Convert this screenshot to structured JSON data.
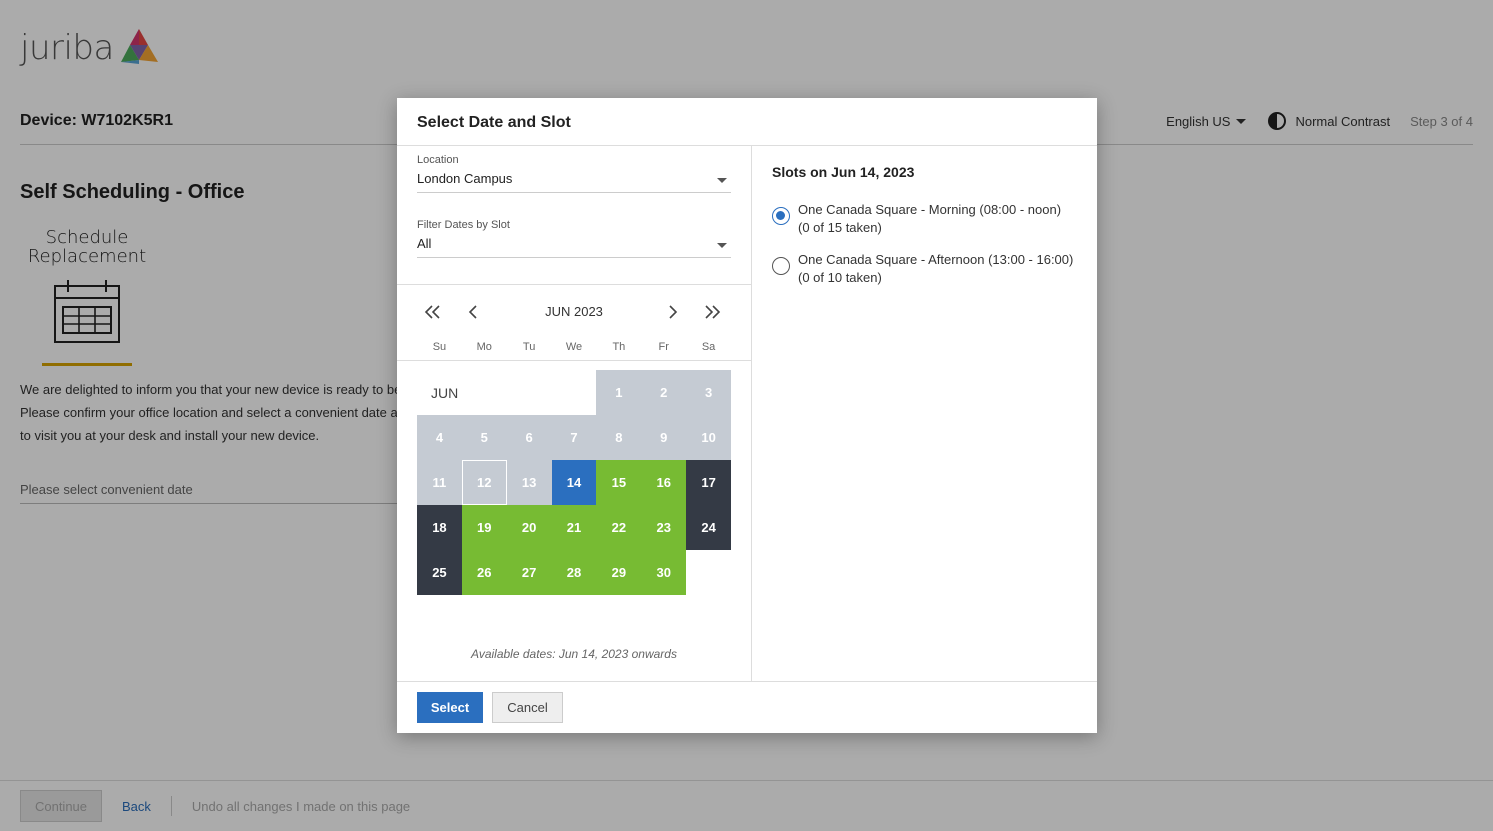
{
  "brand": {
    "logo_text": "juriba",
    "logo_icon": "juriba-triangle-logo"
  },
  "header": {
    "device_title": "Device: W7102K5R1",
    "language": "English US",
    "contrast": "Normal Contrast",
    "step": "Step 3 of 4"
  },
  "main": {
    "section_title": "Self Scheduling - Office",
    "schedule_card": {
      "line1": "Schedule",
      "line2": "Replacement",
      "icon": "calendar-icon",
      "underline_color": "#d7a300"
    },
    "intro_lines": [
      "We are delighted to inform you that your new device is ready to be",
      "Please confirm your office location and select a convenient date a",
      "to visit you at your desk and install your new device."
    ],
    "date_field_placeholder": "Please select convenient date"
  },
  "footer": {
    "continue_label": "Continue",
    "back_label": "Back",
    "undo_label": "Undo all changes I made on this page"
  },
  "modal": {
    "title": "Select Date and Slot",
    "location": {
      "label": "Location",
      "value": "London Campus"
    },
    "filter": {
      "label": "Filter Dates by Slot",
      "value": "All"
    },
    "calendar": {
      "month_label": "JUN 2023",
      "month_short": "JUN",
      "weekdays": [
        "Su",
        "Mo",
        "Tu",
        "We",
        "Th",
        "Fr",
        "Sa"
      ],
      "colors": {
        "past": "#c5cbd3",
        "available": "#77bb33",
        "blocked": "#343a45",
        "selected": "#2b6fbf"
      },
      "rows": [
        [
          {
            "d": "1",
            "s": "past"
          },
          {
            "d": "2",
            "s": "past"
          },
          {
            "d": "3",
            "s": "past"
          }
        ],
        [
          {
            "d": "4",
            "s": "past"
          },
          {
            "d": "5",
            "s": "past"
          },
          {
            "d": "6",
            "s": "past"
          },
          {
            "d": "7",
            "s": "past"
          },
          {
            "d": "8",
            "s": "past"
          },
          {
            "d": "9",
            "s": "past"
          },
          {
            "d": "10",
            "s": "past"
          }
        ],
        [
          {
            "d": "11",
            "s": "past"
          },
          {
            "d": "12",
            "s": "today"
          },
          {
            "d": "13",
            "s": "past"
          },
          {
            "d": "14",
            "s": "selected"
          },
          {
            "d": "15",
            "s": "avail"
          },
          {
            "d": "16",
            "s": "avail"
          },
          {
            "d": "17",
            "s": "blocked"
          }
        ],
        [
          {
            "d": "18",
            "s": "blocked"
          },
          {
            "d": "19",
            "s": "avail"
          },
          {
            "d": "20",
            "s": "avail"
          },
          {
            "d": "21",
            "s": "avail"
          },
          {
            "d": "22",
            "s": "avail"
          },
          {
            "d": "23",
            "s": "avail"
          },
          {
            "d": "24",
            "s": "blocked"
          }
        ],
        [
          {
            "d": "25",
            "s": "blocked"
          },
          {
            "d": "26",
            "s": "avail"
          },
          {
            "d": "27",
            "s": "avail"
          },
          {
            "d": "28",
            "s": "avail"
          },
          {
            "d": "29",
            "s": "avail"
          },
          {
            "d": "30",
            "s": "avail"
          },
          {
            "d": "",
            "s": "empty"
          }
        ]
      ],
      "available_note": "Available dates: Jun 14, 2023 onwards"
    },
    "slots": {
      "title": "Slots on Jun 14, 2023",
      "items": [
        {
          "label": "One Canada Square - Morning (08:00 - noon) (0 of 15 taken)",
          "checked": true
        },
        {
          "label": "One Canada Square - Afternoon (13:00 - 16:00) (0 of 10 taken)",
          "checked": false
        }
      ]
    },
    "select_label": "Select",
    "cancel_label": "Cancel"
  }
}
